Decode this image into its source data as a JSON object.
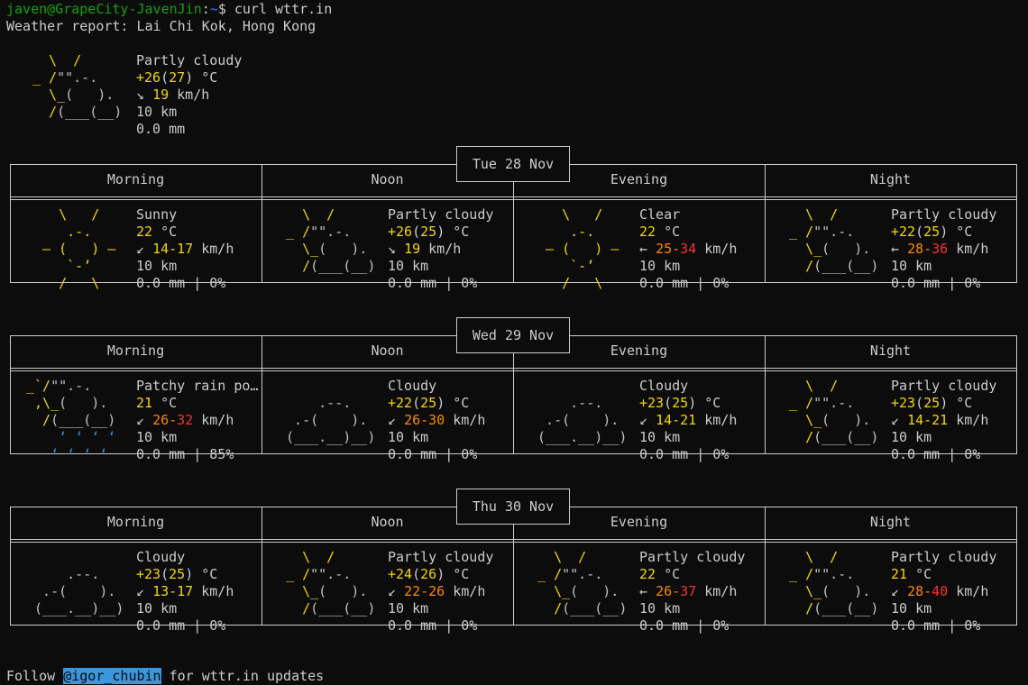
{
  "terminal": {
    "prompt_user": "javen@GrapeCity-JavenJin",
    "prompt_sep": ":",
    "prompt_path": "~",
    "prompt_sign": "$ ",
    "command": "curl wttr.in",
    "report_title": "Weather report: Lai Chi Kok, Hong Kong"
  },
  "current": {
    "condition": "Partly cloudy",
    "temp": "+26",
    "feels": "27",
    "unit": "°C",
    "wind_arrow": "↘",
    "wind": "19",
    "wind_unit": "km/h",
    "visibility": "10 km",
    "precip": "0.0 mm"
  },
  "periods": [
    "Morning",
    "Noon",
    "Evening",
    "Night"
  ],
  "days": [
    {
      "date": "Tue 28 Nov",
      "slots": [
        {
          "icon": "sunny-icon",
          "condition": "Sunny",
          "temp": "22",
          "feels": "",
          "unit": "°C",
          "wind_arrow": "↙",
          "wind_lo": "14",
          "wind_hi": "17",
          "wind_unit": "km/h",
          "visibility": "10 km",
          "precip": "0.0 mm | 0%"
        },
        {
          "icon": "partly-cloudy-icon",
          "condition": "Partly cloudy",
          "temp": "+26",
          "feels": "25",
          "unit": "°C",
          "wind_arrow": "↘",
          "wind_lo": "19",
          "wind_hi": "",
          "wind_unit": "km/h",
          "visibility": "10 km",
          "precip": "0.0 mm | 0%"
        },
        {
          "icon": "clear-icon",
          "condition": "Clear",
          "temp": "22",
          "feels": "",
          "unit": "°C",
          "wind_arrow": "←",
          "wind_lo": "25",
          "wind_hi": "34",
          "wind_unit": "km/h",
          "visibility": "10 km",
          "precip": "0.0 mm | 0%"
        },
        {
          "icon": "partly-cloudy-icon",
          "condition": "Partly cloudy",
          "temp": "+22",
          "feels": "25",
          "unit": "°C",
          "wind_arrow": "←",
          "wind_lo": "28",
          "wind_hi": "36",
          "wind_unit": "km/h",
          "visibility": "10 km",
          "precip": "0.0 mm | 0%"
        }
      ]
    },
    {
      "date": "Wed 29 Nov",
      "slots": [
        {
          "icon": "patchy-rain-icon",
          "condition": "Patchy rain po…",
          "temp": "21",
          "feels": "",
          "unit": "°C",
          "wind_arrow": "↙",
          "wind_lo": "26",
          "wind_hi": "32",
          "wind_unit": "km/h",
          "visibility": "10 km",
          "precip": "0.0 mm | 85%"
        },
        {
          "icon": "cloudy-icon",
          "condition": "Cloudy",
          "temp": "+22",
          "feels": "25",
          "unit": "°C",
          "wind_arrow": "↙",
          "wind_lo": "26",
          "wind_hi": "30",
          "wind_unit": "km/h",
          "visibility": "10 km",
          "precip": "0.0 mm | 0%"
        },
        {
          "icon": "cloudy-icon",
          "condition": "Cloudy",
          "temp": "+23",
          "feels": "25",
          "unit": "°C",
          "wind_arrow": "↙",
          "wind_lo": "14",
          "wind_hi": "21",
          "wind_unit": "km/h",
          "visibility": "10 km",
          "precip": "0.0 mm | 0%"
        },
        {
          "icon": "partly-cloudy-icon",
          "condition": "Partly cloudy",
          "temp": "+23",
          "feels": "25",
          "unit": "°C",
          "wind_arrow": "↙",
          "wind_lo": "14",
          "wind_hi": "21",
          "wind_unit": "km/h",
          "visibility": "10 km",
          "precip": "0.0 mm | 0%"
        }
      ]
    },
    {
      "date": "Thu 30 Nov",
      "slots": [
        {
          "icon": "cloudy-icon",
          "condition": "Cloudy",
          "temp": "+23",
          "feels": "25",
          "unit": "°C",
          "wind_arrow": "↙",
          "wind_lo": "13",
          "wind_hi": "17",
          "wind_unit": "km/h",
          "visibility": "10 km",
          "precip": "0.0 mm | 0%"
        },
        {
          "icon": "partly-cloudy-icon",
          "condition": "Partly cloudy",
          "temp": "+24",
          "feels": "26",
          "unit": "°C",
          "wind_arrow": "↙",
          "wind_lo": "22",
          "wind_hi": "26",
          "wind_unit": "km/h",
          "visibility": "10 km",
          "precip": "0.0 mm | 0%"
        },
        {
          "icon": "partly-cloudy-icon",
          "condition": "Partly cloudy",
          "temp": "22",
          "feels": "",
          "unit": "°C",
          "wind_arrow": "←",
          "wind_lo": "26",
          "wind_hi": "37",
          "wind_unit": "km/h",
          "visibility": "10 km",
          "precip": "0.0 mm | 0%"
        },
        {
          "icon": "partly-cloudy-icon",
          "condition": "Partly cloudy",
          "temp": "21",
          "feels": "",
          "unit": "°C",
          "wind_arrow": "↙",
          "wind_lo": "28",
          "wind_hi": "40",
          "wind_unit": "km/h",
          "visibility": "10 km",
          "precip": "0.0 mm | 0%"
        }
      ]
    }
  ],
  "footer": {
    "prefix": "Follow ",
    "handle": "@igor_chubin",
    "suffix": " for wttr.in updates"
  },
  "colors": {
    "background": "#0c0c0c",
    "text": "#cccccc",
    "prompt_user": "#13a10e",
    "prompt_path": "#3b78ff",
    "temp": "#f2d70a",
    "wind_mid": "#ff8700",
    "wind_high": "#ff3030",
    "rain": "#3b8eea",
    "handle_bg": "#3a96dd"
  }
}
